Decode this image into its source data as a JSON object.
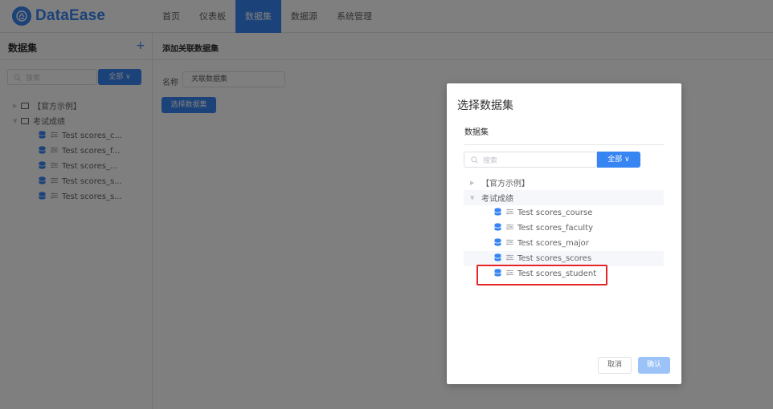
{
  "app": {
    "logo_text": "DataEase"
  },
  "nav": {
    "items": [
      {
        "label": "首页"
      },
      {
        "label": "仪表板"
      },
      {
        "label": "数据集"
      },
      {
        "label": "数据源"
      },
      {
        "label": "系统管理"
      }
    ],
    "active_index": 2
  },
  "sidebar": {
    "title": "数据集",
    "add_symbol": "+",
    "search_placeholder": "搜索",
    "filter_label": "全部 ∨",
    "tree": [
      {
        "label": "【官方示例】"
      },
      {
        "label": "考试成绩"
      }
    ],
    "datasets": [
      {
        "label": "Test scores_c..."
      },
      {
        "label": "Test scores_f..."
      },
      {
        "label": "Test scores_..."
      },
      {
        "label": "Test scores_s..."
      },
      {
        "label": "Test scores_s..."
      }
    ]
  },
  "main": {
    "title": "添加关联数据集",
    "name_label": "名称",
    "name_value": "关联数据集",
    "select_button": "选择数据集"
  },
  "dialog": {
    "title": "选择数据集",
    "subtitle": "数据集",
    "search_placeholder": "搜索",
    "filter_label": "全部 ∨",
    "tree": [
      {
        "label": "【官方示例】"
      },
      {
        "label": "考试成绩"
      }
    ],
    "datasets": [
      {
        "label": "Test scores_course"
      },
      {
        "label": "Test scores_faculty"
      },
      {
        "label": "Test scores_major"
      },
      {
        "label": "Test scores_scores"
      },
      {
        "label": "Test scores_student"
      }
    ],
    "cancel_label": "取消",
    "confirm_label": "确认"
  },
  "colors": {
    "accent": "#3685f2",
    "highlight": "#e5252a"
  }
}
